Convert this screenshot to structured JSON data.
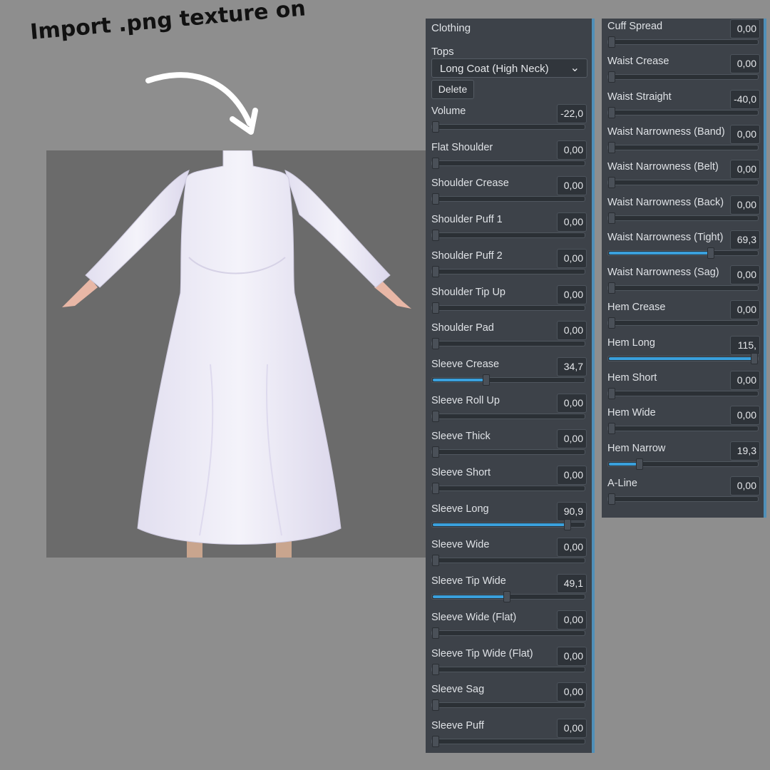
{
  "annotation": {
    "text": "Import .png texture on"
  },
  "viewport": {
    "model_name": "character-model"
  },
  "left_panel": {
    "title": "Clothing",
    "category_label": "Tops",
    "dropdown_value": "Long Coat (High Neck)",
    "delete_label": "Delete",
    "sliders": [
      {
        "label": "Volume",
        "value": "-22,0",
        "level": 0
      },
      {
        "label": "Flat Shoulder",
        "value": "0,00",
        "level": 0
      },
      {
        "label": "Shoulder Crease",
        "value": "0,00",
        "level": 0
      },
      {
        "label": "Shoulder Puff 1",
        "value": "0,00",
        "level": 0
      },
      {
        "label": "Shoulder Puff 2",
        "value": "0,00",
        "level": 0
      },
      {
        "label": "Shoulder Tip Up",
        "value": "0,00",
        "level": 0
      },
      {
        "label": "Shoulder Pad",
        "value": "0,00",
        "level": 0
      },
      {
        "label": "Sleeve Crease",
        "value": "34,7",
        "level": 0.347
      },
      {
        "label": "Sleeve Roll Up",
        "value": "0,00",
        "level": 0
      },
      {
        "label": "Sleeve Thick",
        "value": "0,00",
        "level": 0
      },
      {
        "label": "Sleeve Short",
        "value": "0,00",
        "level": 0
      },
      {
        "label": "Sleeve Long",
        "value": "90,9",
        "level": 0.909
      },
      {
        "label": "Sleeve Wide",
        "value": "0,00",
        "level": 0
      },
      {
        "label": "Sleeve Tip Wide",
        "value": "49,1",
        "level": 0.491
      },
      {
        "label": "Sleeve Wide (Flat)",
        "value": "0,00",
        "level": 0
      },
      {
        "label": "Sleeve Tip Wide (Flat)",
        "value": "0,00",
        "level": 0
      },
      {
        "label": "Sleeve Sag",
        "value": "0,00",
        "level": 0
      },
      {
        "label": "Sleeve Puff",
        "value": "0,00",
        "level": 0
      }
    ]
  },
  "right_panel": {
    "sliders": [
      {
        "label": "Cuff Spread",
        "value": "0,00",
        "level": 0
      },
      {
        "label": "Waist Crease",
        "value": "0,00",
        "level": 0
      },
      {
        "label": "Waist Straight",
        "value": "-40,0",
        "level": 0
      },
      {
        "label": "Waist Narrowness (Band)",
        "value": "0,00",
        "level": 0
      },
      {
        "label": "Waist Narrowness (Belt)",
        "value": "0,00",
        "level": 0
      },
      {
        "label": "Waist Narrowness (Back)",
        "value": "0,00",
        "level": 0
      },
      {
        "label": "Waist Narrowness (Tight)",
        "value": "69,3",
        "level": 0.693
      },
      {
        "label": "Waist Narrowness (Sag)",
        "value": "0,00",
        "level": 0
      },
      {
        "label": "Hem Crease",
        "value": "0,00",
        "level": 0
      },
      {
        "label": "Hem Long",
        "value": "115,",
        "level": 1.0
      },
      {
        "label": "Hem Short",
        "value": "0,00",
        "level": 0
      },
      {
        "label": "Hem Wide",
        "value": "0,00",
        "level": 0
      },
      {
        "label": "Hem Narrow",
        "value": "19,3",
        "level": 0.193
      },
      {
        "label": "A-Line",
        "value": "0,00",
        "level": 0
      }
    ]
  },
  "colors": {
    "panel_bg": "#3d4249",
    "accent": "#3aa0dc",
    "page_bg": "#8e8e8e"
  }
}
